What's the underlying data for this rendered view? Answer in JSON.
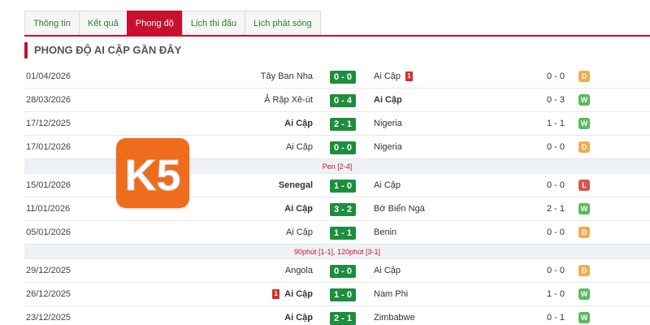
{
  "tabs": [
    {
      "label": "Thông tin",
      "active": false
    },
    {
      "label": "Kết quả",
      "active": false
    },
    {
      "label": "Phong độ",
      "active": true
    },
    {
      "label": "Lịch thi đấu",
      "active": false
    },
    {
      "label": "Lịch phát sóng",
      "active": false
    }
  ],
  "section_title": "PHONG ĐỘ AI CẬP GẦN ĐÂY",
  "logo_text": "K5",
  "colors": {
    "accent": "#c8102e",
    "score_bg": "#1e8e3e",
    "win": "#5cb85c",
    "draw": "#f0ad4e",
    "loss": "#d9534f",
    "logo": "#ee6c1c"
  },
  "rows": [
    {
      "type": "match",
      "date": "01/04/2026",
      "home": "Tây Ban Nha",
      "home_bold": false,
      "score": "0 - 0",
      "away": "Ai Cập",
      "away_bold": false,
      "away_card": "1",
      "ht": "0 - 0",
      "result": "D"
    },
    {
      "type": "match",
      "date": "28/03/2026",
      "home": "Ả Rập Xê-út",
      "home_bold": false,
      "score": "0 - 4",
      "away": "Ai Cập",
      "away_bold": true,
      "ht": "0 - 3",
      "result": "W"
    },
    {
      "type": "match",
      "date": "17/12/2025",
      "home": "Ai Cập",
      "home_bold": true,
      "score": "2 - 1",
      "away": "Nigeria",
      "away_bold": false,
      "ht": "1 - 1",
      "result": "W"
    },
    {
      "type": "match",
      "date": "17/01/2026",
      "home": "Ai Cập",
      "home_bold": false,
      "score": "0 - 0",
      "away": "Nigeria",
      "away_bold": false,
      "ht": "0 - 0",
      "result": "D"
    },
    {
      "type": "note",
      "text": "Pen [2-4]"
    },
    {
      "type": "match",
      "date": "15/01/2026",
      "home": "Senegal",
      "home_bold": true,
      "score": "1 - 0",
      "away": "Ai Cập",
      "away_bold": false,
      "ht": "0 - 0",
      "result": "L"
    },
    {
      "type": "match",
      "date": "11/01/2026",
      "home": "Ai Cập",
      "home_bold": true,
      "score": "3 - 2",
      "away": "Bờ Biển Ngà",
      "away_bold": false,
      "ht": "2 - 1",
      "result": "W"
    },
    {
      "type": "match",
      "date": "05/01/2026",
      "home": "Ai Cập",
      "home_bold": false,
      "score": "1 - 1",
      "away": "Benin",
      "away_bold": false,
      "ht": "0 - 0",
      "result": "D"
    },
    {
      "type": "note",
      "text": "90phút [1-1], 120phút [3-1]"
    },
    {
      "type": "match",
      "date": "29/12/2025",
      "home": "Angola",
      "home_bold": false,
      "score": "0 - 0",
      "away": "Ai Cập",
      "away_bold": false,
      "ht": "0 - 0",
      "result": "D"
    },
    {
      "type": "match",
      "date": "26/12/2025",
      "home": "Ai Cập",
      "home_bold": true,
      "home_card": "1",
      "score": "1 - 0",
      "away": "Nam Phi",
      "away_bold": false,
      "ht": "1 - 0",
      "result": "W"
    },
    {
      "type": "match",
      "date": "23/12/2025",
      "home": "Ai Cập",
      "home_bold": true,
      "score": "2 - 1",
      "away": "Zimbabwe",
      "away_bold": false,
      "ht": "0 - 1",
      "result": "W"
    }
  ]
}
